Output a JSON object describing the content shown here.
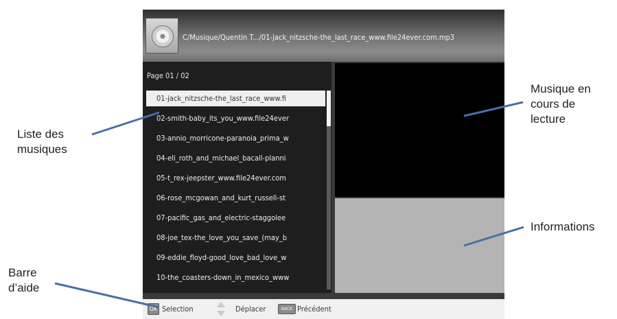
{
  "header": {
    "path_text": "C/Musique/Quentin T.../01-jack_nitzsche-the_last_race_www.file24ever.com.mp3"
  },
  "playlist": {
    "page_indicator": "Page  01 / 02",
    "tracks": [
      "01-jack_nitzsche-the_last_race_www.fi",
      "02-smith-baby_its_you_www.file24ever",
      "03-annio_morricone-paranoia_prima_w",
      "04-eli_roth_and_michael_bacall-planni",
      "05-t_rex-jeepster_www.file24ever.com",
      "06-rose_mcgowan_and_kurt_russell-st",
      "07-pacific_gas_and_electric-staggolee",
      "08-joe_tex-the_love_you_save_(may_b",
      "09-eddie_floyd-good_love_bad_love_w",
      "10-the_coasters-down_in_mexico_www"
    ],
    "selected_index": 0
  },
  "help_bar": {
    "ok_key": "OK",
    "selection_label": "Selection",
    "move_label": "Déplacer",
    "back_key": "BACK",
    "back_label": "Précédent"
  },
  "callouts": {
    "playlist": "Liste des\nmusiques",
    "now_playing": "Musique en\ncours de\nlecture",
    "info": "Informations",
    "help_bar": "Barre\nd’aide"
  },
  "colors": {
    "callout_line": "#4a6fa5"
  }
}
